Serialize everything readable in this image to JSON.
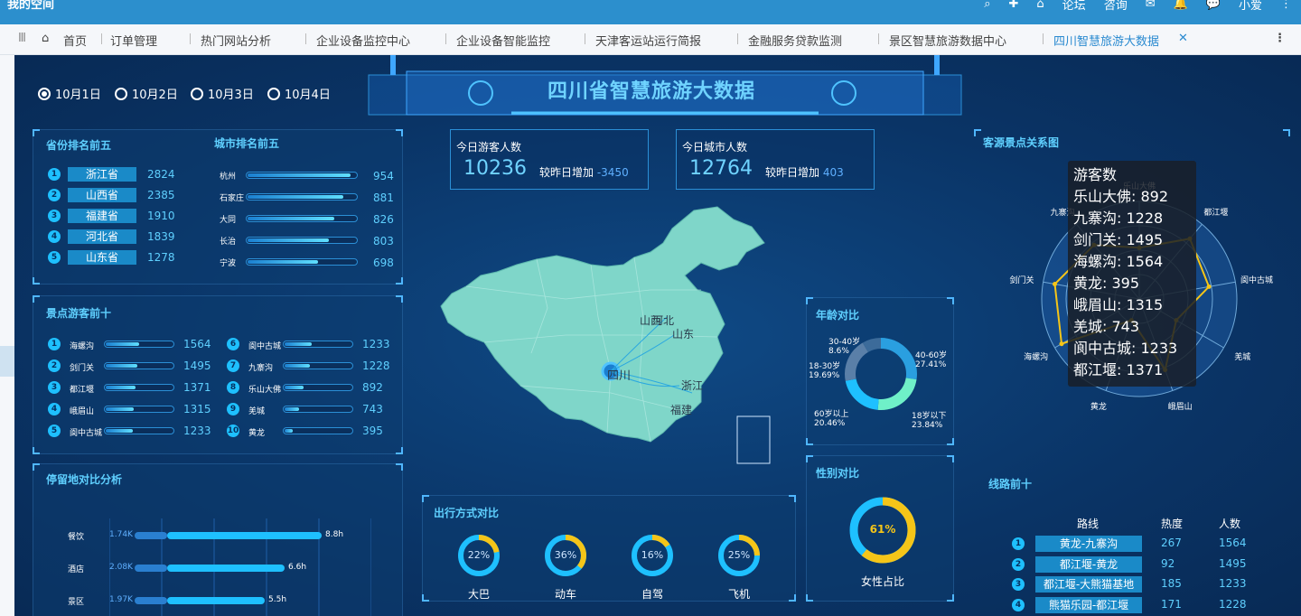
{
  "topbar": {
    "title": "我的空间",
    "items": [
      "论坛",
      "咨询",
      "小爱"
    ],
    "icons": [
      "search-icon",
      "plus-icon",
      "home-icon",
      "bell-icon",
      "mail-icon",
      "chat-icon",
      "avatar"
    ]
  },
  "tabs": [
    "首页",
    "订单管理",
    "热门网站分析",
    "企业设备监控中心",
    "企业设备智能监控",
    "天津客运站运行简报",
    "金融服务贷款监测",
    "景区智慧旅游数据中心",
    "四川智慧旅游大数据"
  ],
  "header": {
    "title": "四川省智慧旅游大数据"
  },
  "dates": [
    "10月1日",
    "10月2日",
    "10月3日",
    "10月4日"
  ],
  "selected_date": "10月1日",
  "province_rank": {
    "title": "省份排名前五",
    "items": [
      {
        "rank": "1",
        "name": "浙江省",
        "value": "2824"
      },
      {
        "rank": "2",
        "name": "山西省",
        "value": "2385"
      },
      {
        "rank": "3",
        "name": "福建省",
        "value": "1910"
      },
      {
        "rank": "4",
        "name": "河北省",
        "value": "1839"
      },
      {
        "rank": "5",
        "name": "山东省",
        "value": "1278"
      }
    ]
  },
  "city_rank": {
    "title": "城市排名前五",
    "items": [
      {
        "name": "杭州",
        "value": "954",
        "pct": 0.95
      },
      {
        "name": "石家庄",
        "value": "881",
        "pct": 0.88
      },
      {
        "name": "大同",
        "value": "826",
        "pct": 0.8
      },
      {
        "name": "长治",
        "value": "803",
        "pct": 0.75
      },
      {
        "name": "宁波",
        "value": "698",
        "pct": 0.65
      }
    ]
  },
  "spots": {
    "title": "景点游客前十",
    "items": [
      {
        "rank": "1",
        "name": "海螺沟",
        "value": "1564",
        "pct": 0.5
      },
      {
        "rank": "2",
        "name": "剑门关",
        "value": "1495",
        "pct": 0.47
      },
      {
        "rank": "3",
        "name": "都江堰",
        "value": "1371",
        "pct": 0.45
      },
      {
        "rank": "4",
        "name": "峨眉山",
        "value": "1315",
        "pct": 0.42
      },
      {
        "rank": "5",
        "name": "阆中古城",
        "value": "1233",
        "pct": 0.4
      },
      {
        "rank": "6",
        "name": "阆中古城",
        "value": "1233",
        "pct": 0.4
      },
      {
        "rank": "7",
        "name": "九寨沟",
        "value": "1228",
        "pct": 0.38
      },
      {
        "rank": "8",
        "name": "乐山大佛",
        "value": "892",
        "pct": 0.28
      },
      {
        "rank": "9",
        "name": "羌城",
        "value": "743",
        "pct": 0.22
      },
      {
        "rank": "10",
        "name": "黄龙",
        "value": "395",
        "pct": 0.12
      }
    ]
  },
  "stay": {
    "title": "停留地对比分析",
    "items": [
      {
        "name": "餐饮",
        "count": "1.74K",
        "hours": "8.8h",
        "pct": 0.95
      },
      {
        "name": "酒店",
        "count": "2.08K",
        "hours": "6.6h",
        "pct": 0.72
      },
      {
        "name": "景区",
        "count": "1.97K",
        "hours": "5.5h",
        "pct": 0.6
      }
    ]
  },
  "kpi": [
    {
      "title": "今日游客人数",
      "value": "10236",
      "delta_label": "较昨日增加",
      "delta": "-3450"
    },
    {
      "title": "今日城市人数",
      "value": "12764",
      "delta_label": "较昨日增加",
      "delta": "403"
    }
  ],
  "map": {
    "labels": [
      "山西",
      "河北",
      "山东",
      "四川",
      "浙江",
      "福建"
    ]
  },
  "travel": {
    "title": "出行方式对比",
    "items": [
      {
        "name": "大巴",
        "pct": 22,
        "label": "22%"
      },
      {
        "name": "动车",
        "pct": 36,
        "label": "36%"
      },
      {
        "name": "自驾",
        "pct": 16,
        "label": "16%"
      },
      {
        "name": "飞机",
        "pct": 25,
        "label": "25%"
      }
    ]
  },
  "age": {
    "title": "年龄对比",
    "items": [
      {
        "name": "30-40岁",
        "label": "8.6%"
      },
      {
        "name": "40-60岁",
        "label": "27.41%"
      },
      {
        "name": "18-30岁",
        "label": "19.69%"
      },
      {
        "name": "60岁以上",
        "label": "20.46%"
      },
      {
        "name": "18岁以下",
        "label": "23.84%"
      }
    ]
  },
  "gender": {
    "title": "性别对比",
    "pct": 61,
    "label": "61%",
    "caption": "女性占比"
  },
  "radar": {
    "title": "客源景点关系图",
    "axes": [
      "乐山大佛",
      "都江堰",
      "阆中古城",
      "羌城",
      "峨眉山",
      "黄龙",
      "海螺沟",
      "剑门关",
      "九寨沟"
    ],
    "tooltip_title": "游客数",
    "tooltip": [
      "乐山大佛: 892",
      "九寨沟: 1228",
      "剑门关: 1495",
      "海螺沟: 1564",
      "黄龙: 395",
      "峨眉山: 1315",
      "羌城: 743",
      "阆中古城: 1233",
      "都江堰: 1371"
    ]
  },
  "routes": {
    "title": "线路前十",
    "headers": [
      "路线",
      "热度",
      "人数"
    ],
    "items": [
      {
        "rank": "1",
        "name": "黄龙-九寨沟",
        "heat": "267",
        "count": "1564"
      },
      {
        "rank": "2",
        "name": "都江堰-黄龙",
        "heat": "92",
        "count": "1495"
      },
      {
        "rank": "3",
        "name": "都江堰-大熊猫基地",
        "heat": "185",
        "count": "1233"
      },
      {
        "rank": "4",
        "name": "熊猫乐园-都江堰",
        "heat": "171",
        "count": "1228"
      }
    ]
  },
  "colors": {
    "accent": "#5fd0ff",
    "bar": "#1a8ac8",
    "gold": "#f5c518",
    "teal": "#7fd6c9"
  }
}
